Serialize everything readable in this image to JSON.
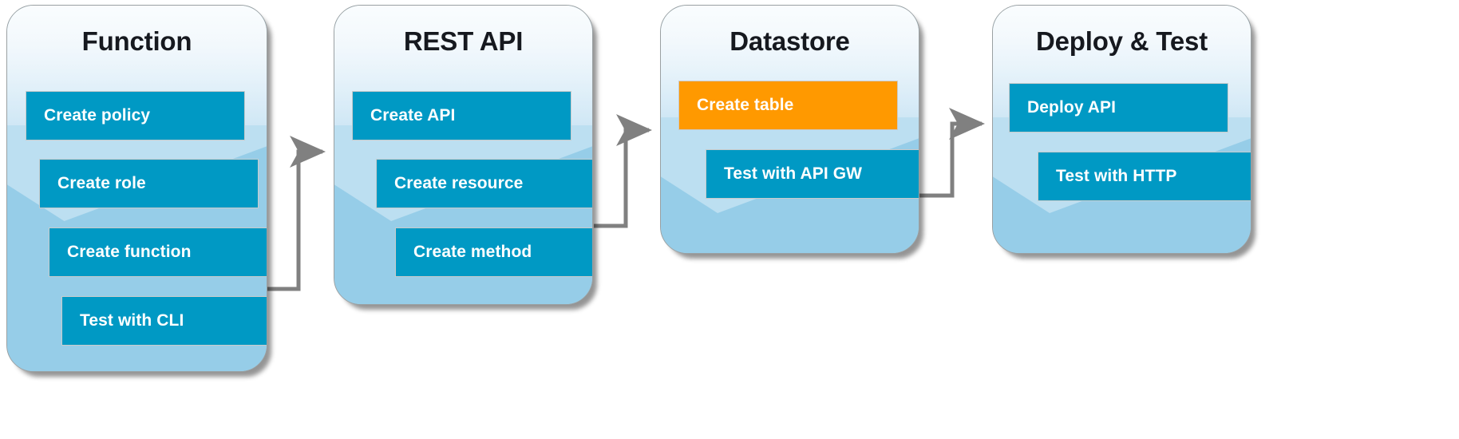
{
  "diagram": {
    "title_semantic": "serverless-api-build-workflow",
    "highlight_color": "#ff9900",
    "step_color": "#0099c4",
    "panel_color": "#a8d6ec",
    "connector_color": "#808080"
  },
  "panels": [
    {
      "id": "function",
      "title": "Function",
      "steps": [
        {
          "label": "Create policy",
          "state": "normal"
        },
        {
          "label": "Create role",
          "state": "normal"
        },
        {
          "label": "Create function",
          "state": "normal"
        },
        {
          "label": "Test with CLI",
          "state": "normal"
        }
      ]
    },
    {
      "id": "rest-api",
      "title": "REST API",
      "steps": [
        {
          "label": "Create API",
          "state": "normal"
        },
        {
          "label": "Create resource",
          "state": "normal"
        },
        {
          "label": "Create method",
          "state": "normal"
        }
      ]
    },
    {
      "id": "datastore",
      "title": "Datastore",
      "steps": [
        {
          "label": "Create table",
          "state": "highlighted"
        },
        {
          "label": "Test with API GW",
          "state": "normal"
        }
      ]
    },
    {
      "id": "deploy-and-test",
      "title": "Deploy & Test",
      "steps": [
        {
          "label": "Deploy API",
          "state": "normal"
        },
        {
          "label": "Test with HTTP",
          "state": "normal"
        }
      ]
    }
  ],
  "connectors": [
    {
      "from": "function",
      "to": "rest-api",
      "name": "arrow-function-to-rest-api"
    },
    {
      "from": "rest-api",
      "to": "datastore",
      "name": "arrow-rest-api-to-datastore"
    },
    {
      "from": "datastore",
      "to": "deploy-and-test",
      "name": "arrow-datastore-to-deploy-and-test"
    }
  ]
}
